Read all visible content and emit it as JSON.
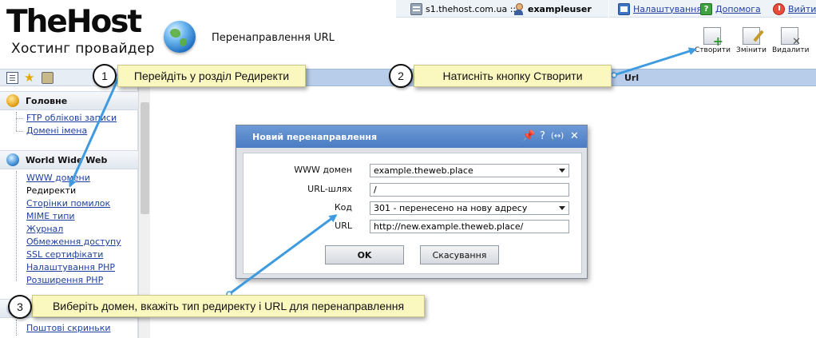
{
  "topbar": {
    "server": "s1.thehost.com.ua ::",
    "user": "exampleuser",
    "settings": "Налаштування",
    "help": "Допомога",
    "exit": "Вийти"
  },
  "header": {
    "logo": "TheHost",
    "tagline": "Хостинг провайдер",
    "page_title": "Перенаправлення URL"
  },
  "toolbar": {
    "create": "Створити",
    "edit": "Змінити",
    "delete": "Видалити"
  },
  "table": {
    "column_url": "Url"
  },
  "sidebar": {
    "groups": [
      {
        "title": "Головне",
        "items": [
          "FTP облікові записи",
          "Домені імена"
        ]
      },
      {
        "title": "World Wide Web",
        "items": [
          "WWW домени",
          "Редиректи",
          "Сторінки помилок",
          "MIME типи",
          "Журнал",
          "Обмеження доступу",
          "SSL сертифікати",
          "Налаштування PHP",
          "Розширення PHP"
        ]
      },
      {
        "title": "",
        "items": [
          "Поштові скриньки"
        ]
      }
    ],
    "active_item": "Редиректи"
  },
  "modal": {
    "title": "Новий перенаправлення",
    "controls": [
      "📌",
      "?",
      "(↔)",
      "✕"
    ],
    "fields": {
      "www_domain": {
        "label": "WWW домен",
        "value": "example.theweb.place"
      },
      "url_path": {
        "label": "URL-шлях",
        "value": "/"
      },
      "code": {
        "label": "Код",
        "value": "301 - перенесено на нову адресу"
      },
      "url": {
        "label": "URL",
        "value": "http://new.example.theweb.place/"
      }
    },
    "ok_label": "OK",
    "cancel_label": "Скасування"
  },
  "callouts": [
    {
      "number": "1",
      "text": "Перейдіть у розділ Редиректи"
    },
    {
      "number": "2",
      "text": "Натисніть кнопку Створити"
    },
    {
      "number": "3",
      "text": "Виберіть домен, вкажіть тип редиректу і URL для перенаправлення"
    }
  ],
  "colors": {
    "accent_blue": "#4a7cc3",
    "callout_bg": "#fbf8bf",
    "arrow": "#3f9be0"
  }
}
